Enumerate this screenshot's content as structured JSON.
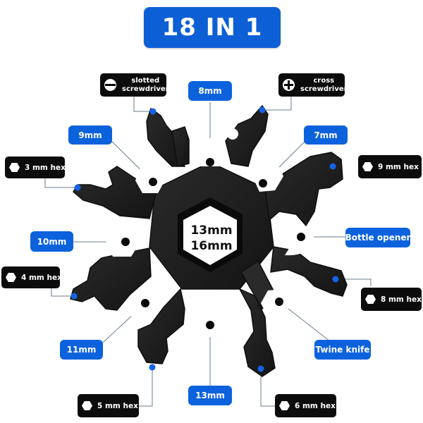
{
  "title": "18 IN 1",
  "center": {
    "line1": "13mm",
    "line2": "16mm"
  },
  "wrench_labels": {
    "8mm": "8mm",
    "9mm": "9mm",
    "7mm": "7mm",
    "10mm": "10mm",
    "bottle": "Bottle opener",
    "11mm": "11mm",
    "twine": "Twine knife",
    "13mm": "13mm"
  },
  "tool_labels": {
    "slotted": "slotted screwdriver",
    "slotted_l1": "slotted",
    "slotted_l2": "screwdriver",
    "cross_l1": "cross",
    "cross_l2": "screwdriver",
    "hex3": "3 mm hex",
    "hex9": "9 mm hex",
    "hex4": "4 mm hex",
    "hex8": "8 mm hex",
    "hex5": "5 mm hex",
    "hex6": "6 mm hex"
  },
  "colors": {
    "accent_blue": "#0b62dc",
    "label_black": "#0c0c0c",
    "tool_body": "#1e1e1e"
  }
}
